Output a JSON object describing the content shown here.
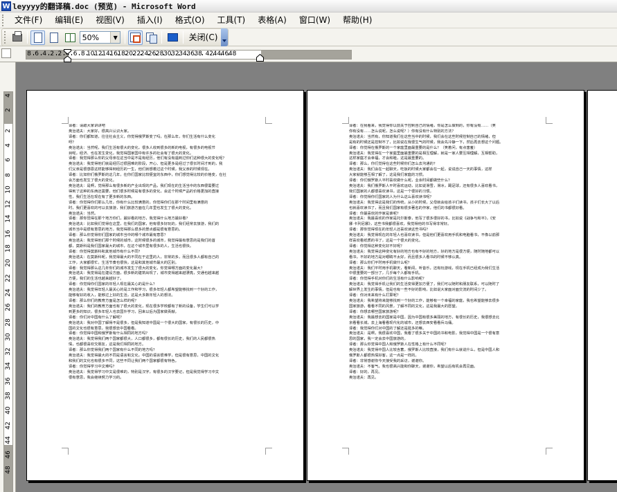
{
  "window": {
    "title": "leyyyy的翻译稿.doc (预览) - Microsoft Word",
    "app_icon_letter": "W"
  },
  "menu": [
    "文件(F)",
    "编辑(E)",
    "视图(V)",
    "插入(I)",
    "格式(O)",
    "工具(T)",
    "表格(A)",
    "窗口(W)",
    "帮助(H)"
  ],
  "toolbar": {
    "zoom_value": "50%",
    "close_label": "关闭(C)",
    "dropdown_glyph": "▼"
  },
  "ruler": {
    "h_labels": [
      "8",
      "6",
      "4",
      "2",
      "2",
      "4",
      "6",
      "8",
      "10",
      "12",
      "14",
      "16",
      "18",
      "20",
      "22",
      "24",
      "26",
      "28",
      "30",
      "32",
      "34",
      "36",
      "38",
      "42",
      "44",
      "46",
      "48"
    ],
    "v_labels": [
      "4",
      "2",
      "2",
      "4",
      "6",
      "8",
      "10",
      "12",
      "14",
      "16",
      "18",
      "20",
      "22",
      "24",
      "26",
      "28",
      "30",
      "32",
      "34",
      "36",
      "38",
      "40",
      "42",
      "44",
      "46",
      "48"
    ]
  },
  "pages": [
    {
      "lines": [
        "译者：请跟大家讲讲吧",
        "奥治诺夫：大家好，很高兴认识大家。",
        "译者：你们都知道，往往社会主义，你觉得俄罗斯变了吗，在那么年，你们生活有什么变化",
        "呀？",
        "奥治诺夫：当然呢，我们生活有很大的变化，很多人收到很多的新的电视，有很多的电视节",
        "目呢，经济、也在发生变化，我觉得国家国中有许多的社会有了很大的变化。",
        "译者：我觉得那么你的父母亲在这当中是不是有经历，他们有没有遇到过你们这种很大的变化呢？",
        "奥治诺夫：我觉得他们就是经历过很困难的阶段，开心、但是更多是经过了很长时间才到的，我",
        "们父亲是很感恩这样能够得到经历的一生，他们就想着过这个时候，我父亲的时候现在。",
        "译者：比如你们俄罗斯的这几年，在你们国家比较便宜的东西中，你们想觉得比较的价格变，在社",
        "会方面也发生了很大的变化。",
        "奥治诺夫：是啊，觉得那么有很多新的产业出现的产品，我们现在的生活当中的东西很需要过",
        "得到了这种的东西还需要，他们很多时候是有很多的变化，会这个时候产品的价格更加的直接",
        "性，我们生活在现在有了更多新的东西。",
        "译者：你觉得你们那么几年，你有什么比较满意的，你觉得你们在那个时间里有满意的",
        "时，我们更喜欢的可以去旅游，我们旅游方面在几年里也发生了很大的变化。",
        "奥治诺夫：当然。",
        "译者：那你觉得在那个地方你们，最好看的地方，我觉得什么地方最好看？",
        "奥治诺夫：比如我们觉得在这里，在我们的国家，他有很多好玩的，我们经常去旅游，我们的",
        "城市当中是很有意思的地方，我觉得那么很多的景点都是很有意思的。",
        "译者：那么你觉得你们国家的城市当中的哪个城市最有意思？",
        "奥治诺夫：我觉得他们那个时候的城市，这时候很多的城市，我觉得最有意思的是我们的首",
        "都，莫斯科是我们国家最大的城市，在这个城市里有很多的人，生活也很快。",
        "译者：你觉得莫斯科和其他城市有什么不同？",
        "奥治诺夫：在莫斯科呢，我觉得最大的不同在于这里的人，非常的多，而且很多人都有自己的",
        "工作，大家都很忙，生活节奏也很快，这是和其他城市最大的区别。",
        "译者：我觉得那么这几年你们的城市发生了很大的变化，你觉得哪方面的变化最大？",
        "奥治诺夫：我觉得是在建设方面，很多新的建筑出现了，城市变得越来越漂亮，交通也越来越",
        "方便，我们的生活也越来越好了。",
        "译者：你觉得你们国家的年轻人现在最关心的是什么？",
        "奥治诺夫：我觉得年轻人最关心的是工作和学习，很多年轻人都希望能够找到一个好的工作，",
        "能够有好的收入，能够过上好的生活，这是大多数年轻人的想法。",
        "译者：那么你们的教育方面是怎么样的呢？",
        "奥治诺夫：我们的教育方面也有了很大的变化，现在很多学校都有了新的设备，学生们可以学",
        "到更多的知识，很多年轻人也去国外学习，回来以后为国家做贡献。",
        "译者：你们对中国有什么了解呢？",
        "奥治诺夫：我对中国了解得不是很多，但是我知道中国是一个很大的国家，有很长的历史，中",
        "国的文化也很有意思，我很想去中国看看。",
        "译者：你觉得中国和俄罗斯有什么相同的地方吗？",
        "奥治诺夫：我觉得我们两个国家都很大，人口都很多，都有很长的历史，我们的人民都很热",
        "情，也都很喜欢交朋友，这是我们相同的地方。",
        "译者：那么你觉得我们两个国家有什么不同的地方吗？",
        "奥治诺夫：我觉得最大的不同是语言和文化，中国的语言很难学，但是很有意思，中国的文化",
        "和我们的文化也有很多不同，这些不同让我们两个国家都很有特色。",
        "译者：你觉得学习中文难吗？",
        "奥治诺夫：我觉得学习中文是很难的，特别是汉字，有很多的汉字要记，但是我觉得学习中文",
        "很有意思，我会继续努力学习的。"
      ]
    },
    {
      "lines": [
        "译者：在我看来，我觉得你以前关于控制自己的情绪，你是怎么做到的，你有没有……（笑",
        "你有没有……怎么说呢，怎么说呢？）你有没有什么特别的方法？",
        "奥治诺夫：当然有，你知道我们在这些当中的时候，我们会在这些时候控制自己的情绪，但",
        "是有的时候还是控制不了，比如说在我很生气的时候，我会先冷静一下，然后再去想这个问题。",
        "译者：你觉得在俄罗斯的一个家庭里面最重要的是什么？（笑着问，有点害羞）",
        "奥治诺夫：我觉得在一个家庭里面最重要的是相互理解，就是一家人要互相理解，互相帮助，",
        "这样家庭才会幸福，才会和睦，这是最重要的。",
        "译者：那么，你们觉得在这些时候你们怎么去沟通的？",
        "奥治诺夫：我们会在一起聊天，吃饭的时候大家都会在一起，说说自己一天的事情，这样",
        "大家就能够互相了解了，这是我们家庭的习惯。",
        "译者：你们俄罗斯人平时喜欢做什么呢，业余时间都做些什么？",
        "奥治诺夫：我们俄罗斯人平时喜欢运动，比如说滑雪，滑冰，踢足球，还有很多人喜欢看书，",
        "我们国家的人都很喜欢读书，这是一个很好的习惯。",
        "译者：你觉得你们国家的人为什么这么喜欢读书呢？",
        "奥治诺夫：我觉得这是我们的传统，从小的时候，父母就会给孩子们读书，孩子们长大了以后",
        "也就喜欢读书了，而且我们国家有很多著名的作家，他们的书都很好看。",
        "译者：你最喜欢的作家是谁呢？",
        "奥治诺夫：我最喜欢的作家是托尔斯泰，他写了很多很好的书，比如说《战争与和平》，《安",
        "娜·卡列尼娜》，这些书我都很喜欢，我觉得他的书写得非常好。",
        "译者：那你觉得现在的年轻人还喜欢读这些书吗？",
        "奥治诺夫：我觉得现在的年轻人也喜欢读书，但是他们更喜欢用手机和电脑看书，不像以前那",
        "样喜欢看纸质的书了，这是一个很大的变化。",
        "译者：你觉得这种变化好不好呢？",
        "奥治诺夫：我觉得这种变化有好的地方也有不好的地方，好的地方是很方便，随时随地都可以",
        "看书，不好的地方是对眼睛不太好，而且很多人看书的时候不够认真。",
        "译者：那么你们平时用手机做什么呢？",
        "奥治诺夫：我们平时用手机聊天，看新闻，听音乐，还有玩游戏，现在手机已经成为我们生活",
        "中很重要的一部分了，几乎每个人都有手机。",
        "译者：你觉得手机对你们的生活有什么影响呢？",
        "奥治诺夫：我觉得手机让我们的生活变得更加方便了，我们可以随时和朋友联系，可以随时了",
        "解世界上发生的事情，但是也有一些不好的影响，比如说大家面对面交流的时间少了。",
        "译者：你对未来有什么打算呢？",
        "奥治诺夫：我希望将来能够找到一个好的工作，能够有一个幸福的家庭，我也希望能够去很多",
        "国家旅游，看看不同的风景，了解不同的文化，这是我最大的愿望。",
        "译者：你想去哪些国家旅游呢？",
        "奥治诺夫：我最想去的国家是中国，因为中国有很多美丽的地方，有很长的历史，我很想去北",
        "京看看长城，去上海看看现代化的城市，还想去西安看看兵马俑。",
        "译者：我觉得你们对中国的了解还是挺多的嘛。",
        "奥治诺夫：是啊，我很喜欢中国，我看了很多关于中国的书和电影，我觉得中国是一个很有意",
        "思的国家，我一定会去中国旅游的。",
        "译者：那么你觉得中国人和俄罗斯人在性格上有什么不同呢？",
        "奥治诺夫：我觉得中国人比较含蓄，俄罗斯人比较直接，我们有什么就说什么，但是中国人和",
        "俄罗斯人都很热情好客，这一点是一样的。",
        "译者：非常感谢你今天接受我的采访，谢谢你。",
        "奥治诺夫：不客气，我也很高兴能和你聊天，谢谢你，希望以后有机会再见面。",
        "译者：好的，再见。",
        "奥治诺夫：再见。"
      ]
    },
    {
      "lines": []
    }
  ]
}
